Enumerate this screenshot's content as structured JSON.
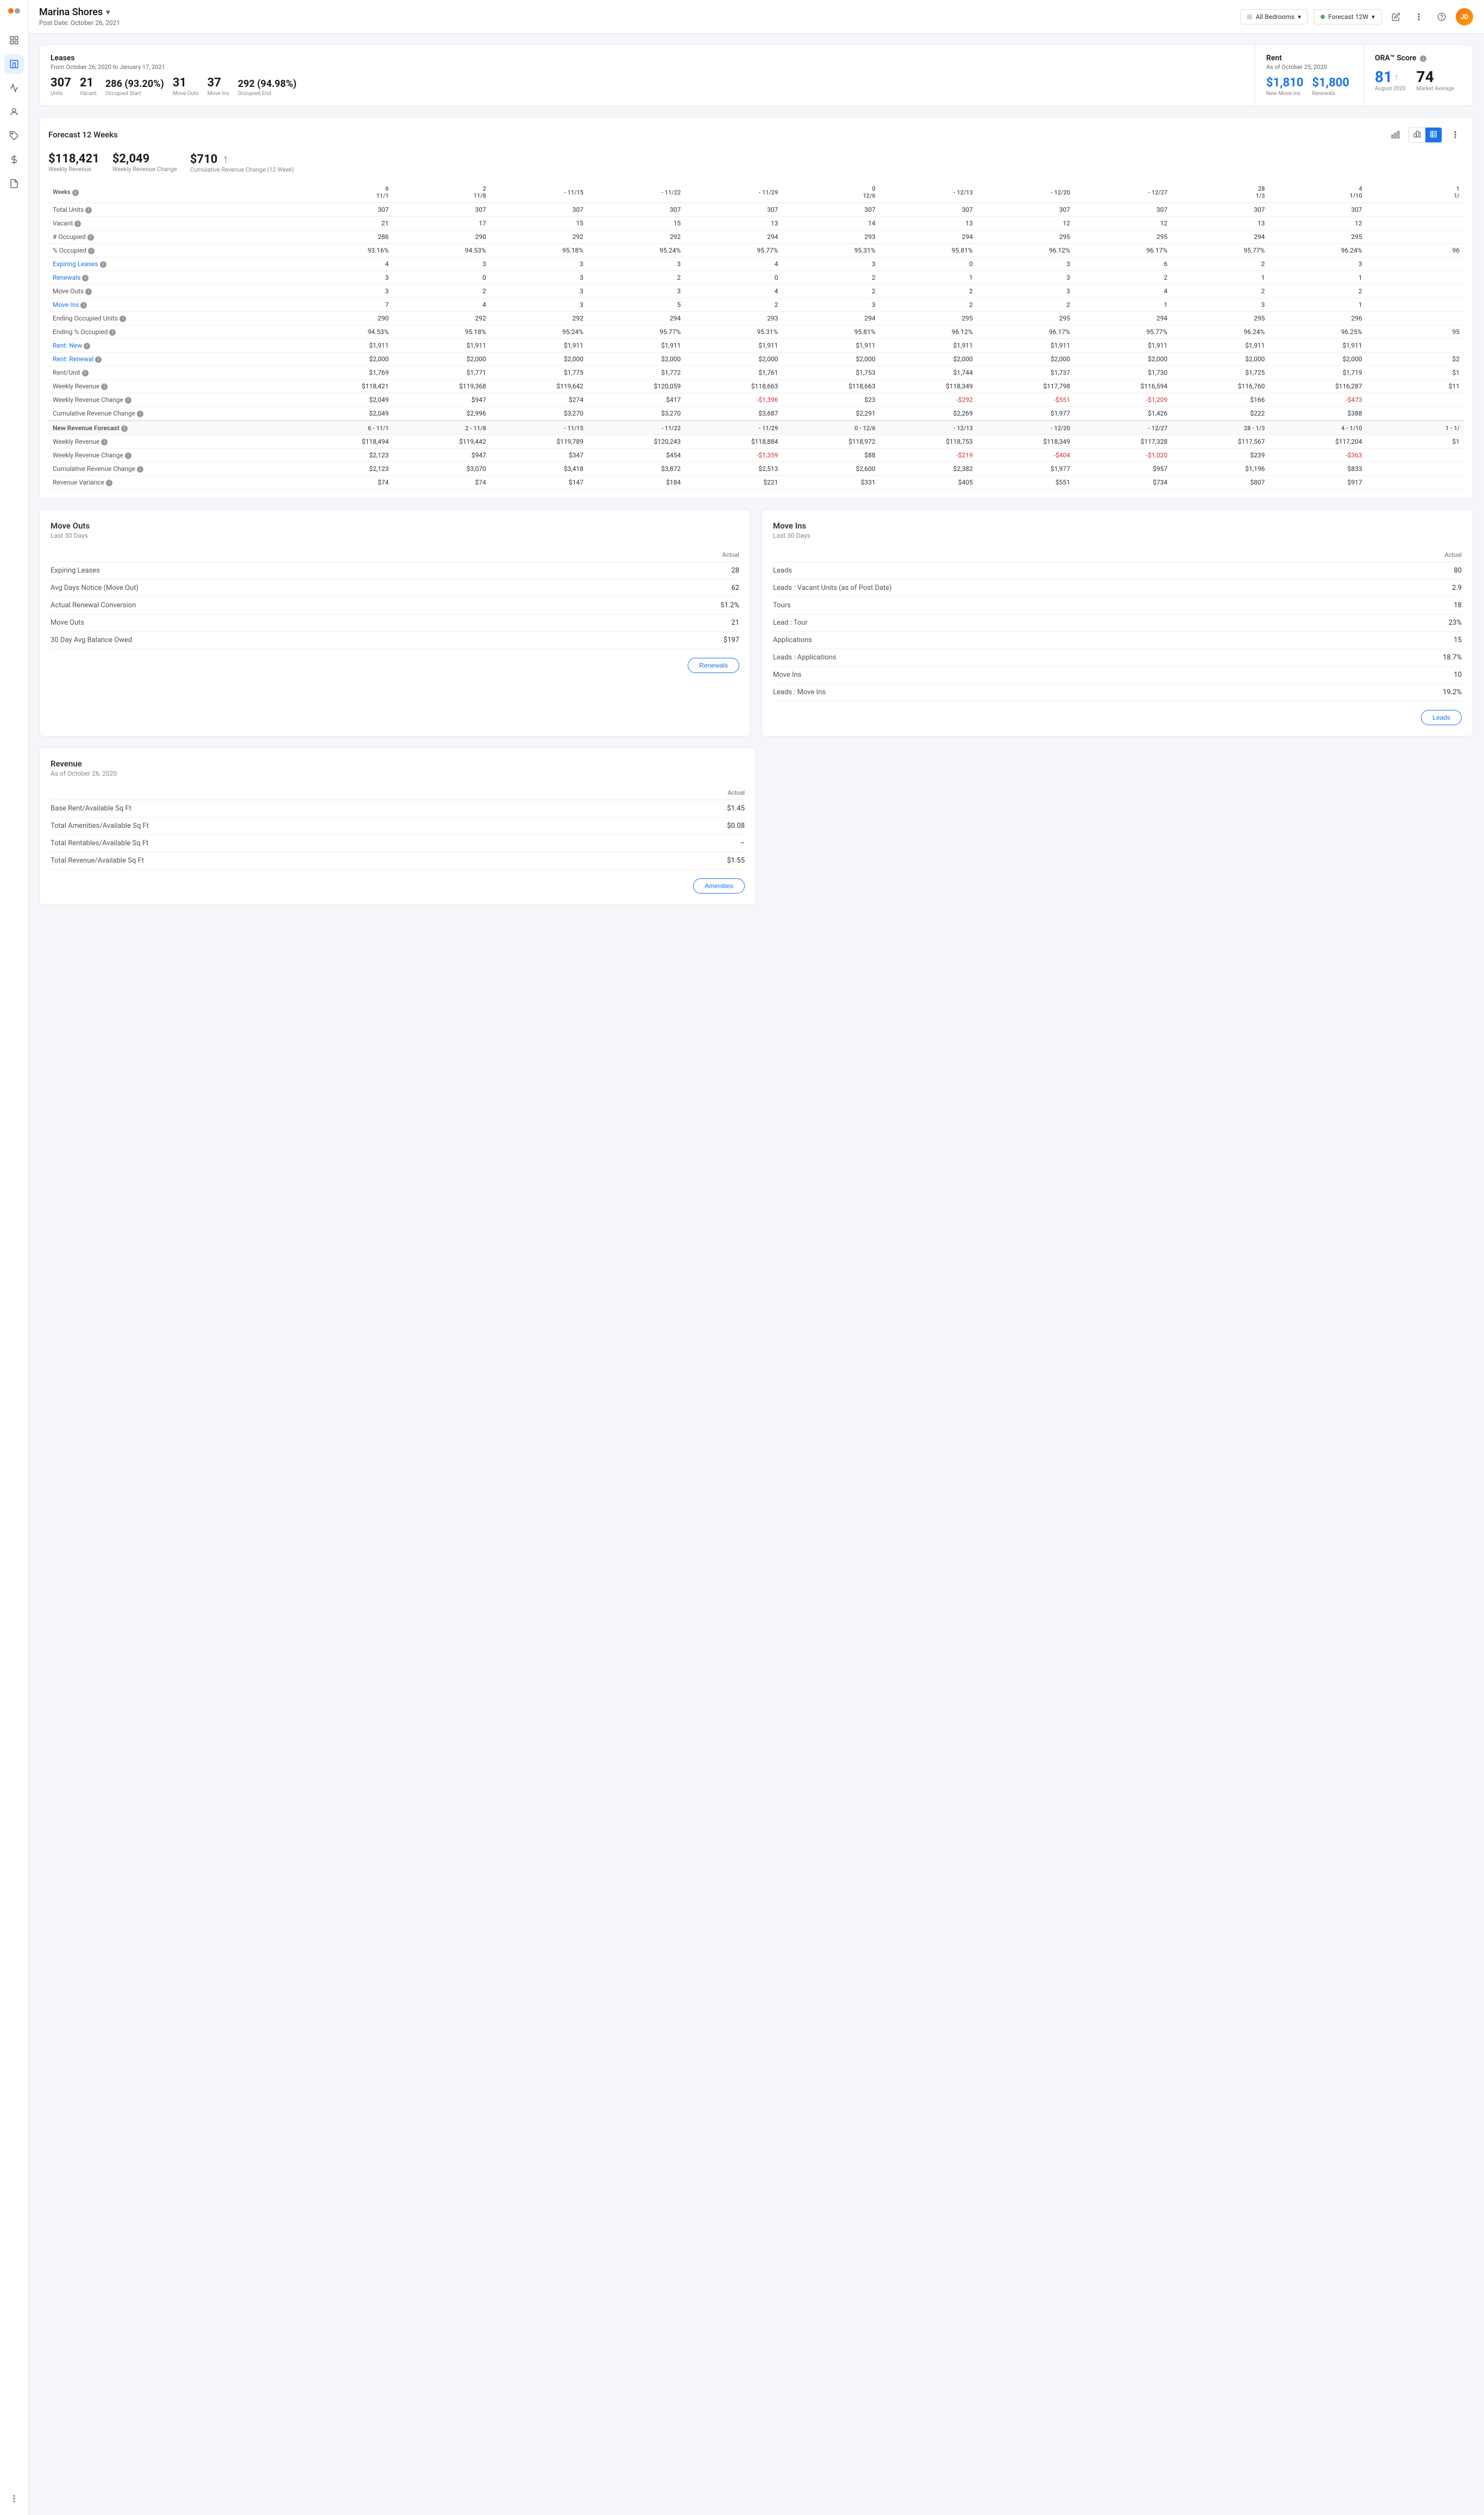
{
  "app": {
    "title": "Marina Shores",
    "post_date": "Post Date: October 26, 2021",
    "property_chevron": "▾"
  },
  "topbar": {
    "filter_bedrooms": "All Bedrooms",
    "filter_forecast": "Forecast 12W",
    "edit_icon": "✎",
    "dots_icon": "⋮"
  },
  "leases_section": {
    "title": "Leases",
    "date_range": "From October 26, 2020 to January 17, 2021",
    "units": "307",
    "units_label": "Units",
    "vacant": "21",
    "vacant_label": "Vacant",
    "occupied_start": "286 (93.20%)",
    "occupied_start_label": "Occupied Start",
    "move_outs": "31",
    "move_outs_label": "Move Outs",
    "move_ins": "37",
    "move_ins_label": "Move Ins",
    "occupied_end": "292 (94.98%)",
    "occupied_end_label": "Occupied End"
  },
  "rent_section": {
    "title": "Rent",
    "as_of": "As of October 25, 2020",
    "new_move_ins": "$1,810",
    "new_move_ins_label": "New Move-Ins",
    "renewals": "$1,800",
    "renewals_label": "Renewals"
  },
  "ora_section": {
    "title": "ORA™ Score",
    "august_value": "81",
    "august_label": "August 2020",
    "arrow": "↑",
    "market_value": "74",
    "market_label": "Market Average"
  },
  "forecast": {
    "title": "Forecast 12 Weeks",
    "weekly_revenue": "$118,421",
    "weekly_revenue_label": "Weekly Revenue",
    "weekly_revenue_change": "$2,049",
    "weekly_revenue_change_label": "Weekly Revenue Change",
    "cumulative_change": "$710",
    "cumulative_change_label": "Cumulative Revenue Change (12 Week)",
    "cumulative_arrow": "↑",
    "columns": [
      "Weeks",
      "6 - 11/1",
      "2 - 11/8",
      "- 11/15",
      "- 11/22",
      "- 11/29",
      "0 - 12/6",
      "- 12/13",
      "- 12/20",
      "- 12/27",
      "28 - 1/3",
      "4 - 1/10",
      "1 - 1/"
    ],
    "rows": [
      {
        "label": "Total Units",
        "info": true,
        "values": [
          "307",
          "307",
          "307",
          "307",
          "307",
          "307",
          "307",
          "307",
          "307",
          "307",
          "307",
          ""
        ]
      },
      {
        "label": "Vacant",
        "info": true,
        "values": [
          "21",
          "17",
          "15",
          "15",
          "13",
          "14",
          "13",
          "12",
          "12",
          "13",
          "12",
          ""
        ]
      },
      {
        "label": "# Occupied",
        "info": true,
        "values": [
          "286",
          "290",
          "292",
          "292",
          "294",
          "293",
          "294",
          "295",
          "295",
          "294",
          "295",
          ""
        ]
      },
      {
        "label": "% Occupied",
        "info": true,
        "values": [
          "93.16%",
          "94.53%",
          "95.18%",
          "95.24%",
          "95.77%",
          "95.31%",
          "95.81%",
          "96.12%",
          "96.17%",
          "95.77%",
          "96.24%",
          "96"
        ]
      },
      {
        "label": "Expiring Leases",
        "info": true,
        "blue": true,
        "values": [
          "4",
          "3",
          "3",
          "3",
          "4",
          "3",
          "0",
          "3",
          "6",
          "2",
          "3",
          ""
        ]
      },
      {
        "label": "Renewals",
        "info": true,
        "blue": true,
        "values": [
          "3",
          "0",
          "3",
          "2",
          "0",
          "2",
          "1",
          "3",
          "2",
          "1",
          "1",
          ""
        ]
      },
      {
        "label": "Move Outs",
        "info": true,
        "values": [
          "3",
          "2",
          "3",
          "3",
          "4",
          "2",
          "2",
          "3",
          "4",
          "2",
          "2",
          ""
        ]
      },
      {
        "label": "Move Ins",
        "info": true,
        "blue": true,
        "values": [
          "7",
          "4",
          "3",
          "5",
          "2",
          "3",
          "2",
          "2",
          "1",
          "3",
          "1",
          ""
        ]
      },
      {
        "label": "Ending Occupied Units",
        "info": true,
        "values": [
          "290",
          "292",
          "292",
          "294",
          "293",
          "294",
          "295",
          "295",
          "294",
          "295",
          "296",
          ""
        ]
      },
      {
        "label": "Ending % Occupied",
        "info": true,
        "values": [
          "94.53%",
          "95.18%",
          "95.24%",
          "95.77%",
          "95.31%",
          "95.81%",
          "96.12%",
          "96.17%",
          "95.77%",
          "96.24%",
          "96.25%",
          "95"
        ]
      },
      {
        "label": "Rent: New",
        "info": true,
        "blue": true,
        "values": [
          "$1,911",
          "$1,911",
          "$1,911",
          "$1,911",
          "$1,911",
          "$1,911",
          "$1,911",
          "$1,911",
          "$1,911",
          "$1,911",
          "$1,911",
          ""
        ]
      },
      {
        "label": "Rent: Renewal",
        "info": true,
        "blue": true,
        "values": [
          "$2,000",
          "$2,000",
          "$2,000",
          "$2,000",
          "$2,000",
          "$2,000",
          "$2,000",
          "$2,000",
          "$2,000",
          "$2,000",
          "$2,000",
          "$2"
        ]
      },
      {
        "label": "Rent/Unit",
        "info": true,
        "values": [
          "$1,769",
          "$1,771",
          "$1,775",
          "$1,772",
          "$1,761",
          "$1,753",
          "$1,744",
          "$1,737",
          "$1,730",
          "$1,725",
          "$1,719",
          "$1"
        ]
      },
      {
        "label": "Weekly Revenue",
        "info": true,
        "values": [
          "$118,421",
          "$119,368",
          "$119,642",
          "$120,059",
          "$118,663",
          "$118,663",
          "$118,349",
          "$117,798",
          "$116,594",
          "$116,760",
          "$116,287",
          "$11"
        ]
      },
      {
        "label": "Weekly Revenue Change",
        "info": true,
        "values": [
          "$2,049",
          "$947",
          "$274",
          "$417",
          "-$1,396",
          "$23",
          "-$292",
          "-$551",
          "-$1,209",
          "$166",
          "-$473",
          ""
        ]
      },
      {
        "label": "Cumulative Revenue Change",
        "info": true,
        "values": [
          "$2,049",
          "$2,996",
          "$3,270",
          "$3,270",
          "$3,687",
          "$2,291",
          "$2,269",
          "$1,977",
          "$1,426",
          "$222",
          "$388",
          ""
        ]
      }
    ],
    "new_revenue_section": {
      "title": "New Revenue Forecast",
      "columns": [
        "",
        "6 - 11/1",
        "2 - 11/8",
        "- 11/15",
        "- 11/22",
        "- 11/29",
        "0 - 12/6",
        "- 12/13",
        "- 12/20",
        "- 12/27",
        "28 - 1/3",
        "4 - 1/10",
        "1 - 1/"
      ],
      "rows": [
        {
          "label": "Weekly Revenue",
          "info": true,
          "values": [
            "$118,494",
            "$119,442",
            "$119,789",
            "$120,243",
            "$118,884",
            "$118,972",
            "$118,753",
            "$118,349",
            "$117,328",
            "$117,567",
            "$117,204",
            "$1"
          ]
        },
        {
          "label": "Weekly Revenue Change",
          "info": true,
          "values": [
            "$2,123",
            "$947",
            "$347",
            "$454",
            "-$1,359",
            "$88",
            "-$219",
            "-$404",
            "-$1,020",
            "$239",
            "-$363",
            ""
          ]
        },
        {
          "label": "Cumulative Revenue Change",
          "info": true,
          "values": [
            "$2,123",
            "$3,070",
            "$3,418",
            "$3,872",
            "$2,513",
            "$2,600",
            "$2,382",
            "$1,977",
            "$957",
            "$1,196",
            "$833",
            ""
          ]
        },
        {
          "label": "Revenue Variance",
          "info": true,
          "values": [
            "$74",
            "$74",
            "$147",
            "$184",
            "$221",
            "$331",
            "$405",
            "$551",
            "$734",
            "$807",
            "$917",
            ""
          ]
        }
      ]
    }
  },
  "move_outs_panel": {
    "title": "Move Outs",
    "subtitle": "Last 30 Days",
    "actual_label": "Actual",
    "rows": [
      {
        "label": "Expiring Leases",
        "value": "28"
      },
      {
        "label": "Avg Days Notice (Move Out)",
        "value": "62"
      },
      {
        "label": "Actual Renewal Conversion",
        "value": "51.2%"
      },
      {
        "label": "Move Outs",
        "value": "21"
      },
      {
        "label": "30 Day Avg Balance Owed",
        "value": "$197"
      }
    ],
    "button_label": "Renewals"
  },
  "move_ins_panel": {
    "title": "Move Ins",
    "subtitle": "Last 30 Days",
    "actual_label": "Actual",
    "rows": [
      {
        "label": "Leads",
        "value": "80"
      },
      {
        "label": "Leads : Vacant Units  (as of Post Date)",
        "value": "2.9"
      },
      {
        "label": "Tours",
        "value": "18"
      },
      {
        "label": "Lead : Tour",
        "value": "23%"
      },
      {
        "label": "Applications",
        "value": "15"
      },
      {
        "label": "Leads : Applications",
        "value": "18.7%"
      },
      {
        "label": "Move Ins",
        "value": "10"
      },
      {
        "label": "Leads : Move Ins",
        "value": "19.2%"
      }
    ],
    "button_label": "Leads"
  },
  "revenue_panel": {
    "title": "Revenue",
    "as_of": "As of October 26, 2020",
    "actual_label": "Actual",
    "rows": [
      {
        "label": "Base Rent/Available Sq Ft",
        "value": "$1.45"
      },
      {
        "label": "Total Amenities/Available Sq Ft",
        "value": "$0.08"
      },
      {
        "label": "Total Rentables/Available Sq Ft",
        "value": "–"
      },
      {
        "label": "Total Revenue/Available Sq Ft",
        "value": "$1.55"
      }
    ],
    "button_label": "Amenities"
  },
  "sidebar": {
    "icons": [
      "grid",
      "building",
      "chart-bar",
      "person",
      "tag",
      "dollar",
      "document",
      "dots"
    ]
  }
}
